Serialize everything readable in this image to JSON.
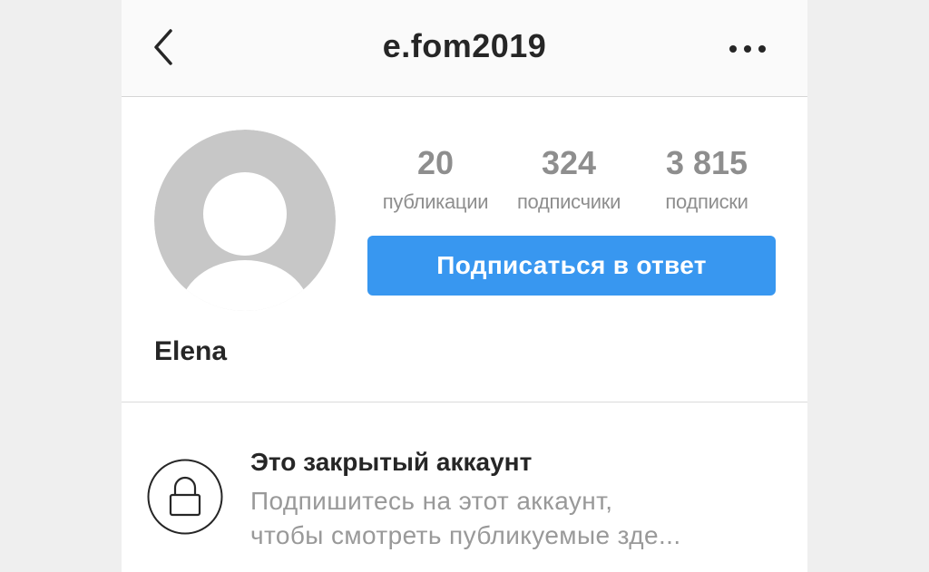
{
  "navbar": {
    "back_icon": "chevron-left-icon",
    "title": "e.fom2019",
    "more_icon": "more-horizontal-icon"
  },
  "profile": {
    "avatar_icon": "default-avatar-icon",
    "name": "Elena",
    "stats": [
      {
        "value": "20",
        "label": "публикации"
      },
      {
        "value": "324",
        "label": "подписчики"
      },
      {
        "value": "3 815",
        "label": "подписки"
      }
    ],
    "follow_button": "Подписаться в ответ"
  },
  "private_account": {
    "lock_icon": "lock-icon",
    "title": "Это закрытый аккаунт",
    "description_line1": "Подпишитесь на этот аккаунт,",
    "description_line2": "чтобы смотреть публикуемые зде..."
  },
  "colors": {
    "accent": "#3897f0",
    "text_primary": "#262626",
    "text_secondary": "#8e8e8e",
    "background": "#efefef"
  }
}
